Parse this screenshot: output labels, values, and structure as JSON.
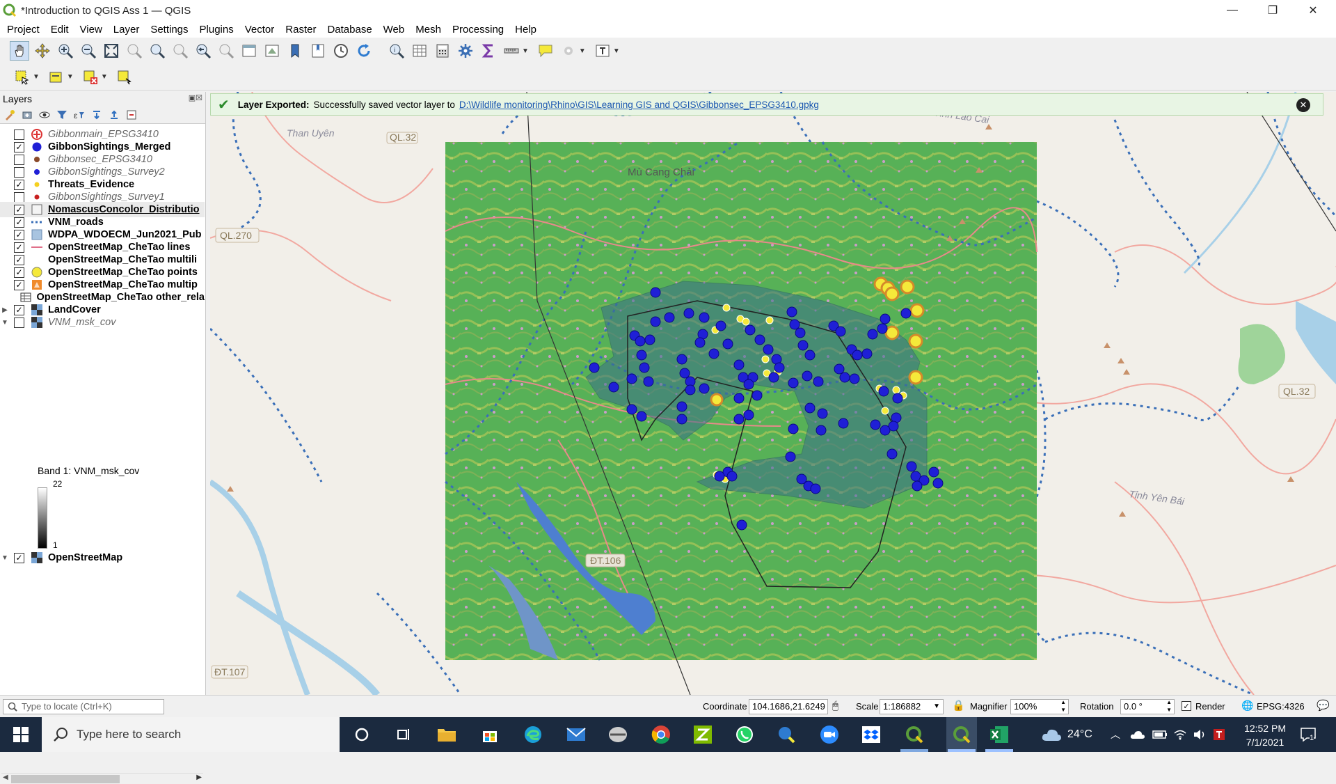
{
  "window": {
    "title": "*Introduction to QGIS Ass 1 — QGIS",
    "minimize": "—",
    "restore": "❐",
    "close": "✕"
  },
  "menu": [
    "Project",
    "Edit",
    "View",
    "Layer",
    "Settings",
    "Plugins",
    "Vector",
    "Raster",
    "Database",
    "Web",
    "Mesh",
    "Processing",
    "Help"
  ],
  "layers_panel": {
    "title": "Layers",
    "layers": [
      {
        "name": "Gibbonmain_EPSG3410",
        "checked": false,
        "style": "off",
        "symbol": "cross-icon"
      },
      {
        "name": "GibbonSightings_Merged",
        "checked": true,
        "style": "on",
        "symbol": "blue-dot-icon"
      },
      {
        "name": "Gibbonsec_EPSG3410",
        "checked": false,
        "style": "off",
        "symbol": "brown-dot-icon"
      },
      {
        "name": "GibbonSightings_Survey2",
        "checked": false,
        "style": "off",
        "symbol": "small-blue-dot-icon"
      },
      {
        "name": "Threats_Evidence",
        "checked": true,
        "style": "on",
        "symbol": "yellow-dot-icon"
      },
      {
        "name": "GibbonSightings_Survey1",
        "checked": false,
        "style": "off",
        "symbol": "red-dot-icon"
      },
      {
        "name": "NomascusConcolor_Distributio",
        "checked": true,
        "style": "selected",
        "symbol": "empty-polygon-icon"
      },
      {
        "name": "VNM_roads",
        "checked": true,
        "style": "on",
        "symbol": "dashed-line-icon"
      },
      {
        "name": "WDPA_WDOECM_Jun2021_Pub",
        "checked": true,
        "style": "on",
        "symbol": "blue-polygon-icon"
      },
      {
        "name": "OpenStreetMap_CheTao lines",
        "checked": true,
        "style": "on",
        "symbol": "pink-line-icon"
      },
      {
        "name": "OpenStreetMap_CheTao multili",
        "checked": true,
        "style": "on",
        "symbol": "none"
      },
      {
        "name": "OpenStreetMap_CheTao points",
        "checked": true,
        "style": "on",
        "symbol": "yellow-ring-icon"
      },
      {
        "name": "OpenStreetMap_CheTao multip",
        "checked": true,
        "style": "on",
        "symbol": "orange-polygon-icon"
      },
      {
        "name": "OpenStreetMap_CheTao other_rela",
        "checked": null,
        "style": "on",
        "symbol": "table-icon"
      },
      {
        "name": "LandCover",
        "checked": true,
        "style": "on",
        "symbol": "raster-icon",
        "expander": "▶"
      },
      {
        "name": "VNM_msk_cov",
        "checked": false,
        "style": "off",
        "symbol": "raster-icon",
        "expander": "▼"
      }
    ],
    "band_label": "Band 1: VNM_msk_cov",
    "ramp_max": "22",
    "ramp_min": "1",
    "bottom_layer": {
      "name": "OpenStreetMap",
      "checked": true,
      "expander": "▼"
    }
  },
  "message": {
    "title": "Layer Exported:",
    "body": "Successfully saved vector layer to",
    "link": "D:\\Wildlife monitoring\\Rhino\\GIS\\Learning GIS and QGIS\\Gibbonsec_EPSG3410.gpkg"
  },
  "map_labels": {
    "ql32_top": "QL.32",
    "than_uyen": "Than Uyên",
    "tinh_lao_cai": "Tỉnh Lào Cai",
    "mu_cang_chai": "Mù Cang Chải",
    "ql270": "QL.270",
    "ql32_right": "QL.32",
    "tinh_yen_bai": "Tỉnh Yên Bái",
    "dt106": "ĐT.106",
    "dt107": "ĐT.107"
  },
  "status": {
    "locate_placeholder": "Type to locate (Ctrl+K)",
    "coordinate_label": "Coordinate",
    "coordinate_value": "104.1686,21.6249",
    "scale_label": "Scale",
    "scale_value": "1:186882",
    "magnifier_label": "Magnifier",
    "magnifier_value": "100%",
    "rotation_label": "Rotation",
    "rotation_value": "0.0 °",
    "render_label": "Render",
    "crs": "EPSG:4326"
  },
  "taskbar": {
    "search_placeholder": "Type here to search",
    "temperature": "24°C",
    "time": "12:52 PM",
    "date": "7/1/2021",
    "notifications": "1"
  },
  "colors": {
    "accent_green": "#5a9e3a",
    "sighting_blue": "#1f1fd6",
    "threat_yellow": "#f5e93a",
    "road_blue": "#3a6fb8",
    "landcover_green": "#5fb85a"
  }
}
